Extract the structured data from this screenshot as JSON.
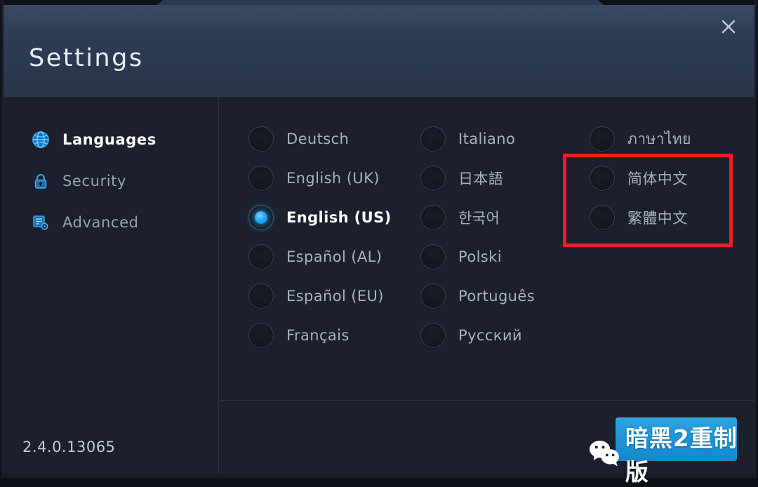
{
  "window": {
    "title": "Settings",
    "close_icon": "close-icon"
  },
  "sidebar": {
    "items": [
      {
        "label": "Languages",
        "icon": "globe-icon",
        "active": true
      },
      {
        "label": "Security",
        "icon": "lock-icon",
        "active": false
      },
      {
        "label": "Advanced",
        "icon": "advanced-settings-icon",
        "active": false
      }
    ]
  },
  "languages": {
    "selected": "English (US)",
    "columns": [
      {
        "options": [
          {
            "label": "Deutsch",
            "selected": false
          },
          {
            "label": "English (UK)",
            "selected": false
          },
          {
            "label": "English (US)",
            "selected": true
          },
          {
            "label": "Español (AL)",
            "selected": false
          },
          {
            "label": "Español (EU)",
            "selected": false
          },
          {
            "label": "Français",
            "selected": false
          }
        ]
      },
      {
        "options": [
          {
            "label": "Italiano",
            "selected": false
          },
          {
            "label": "日本語",
            "selected": false
          },
          {
            "label": "한국어",
            "selected": false
          },
          {
            "label": "Polski",
            "selected": false
          },
          {
            "label": "Português",
            "selected": false
          },
          {
            "label": "Русский",
            "selected": false
          }
        ]
      },
      {
        "options": [
          {
            "label": "ภาษาไทย",
            "selected": false
          },
          {
            "label": "简体中文",
            "selected": false
          },
          {
            "label": "繁體中文",
            "selected": false
          }
        ]
      }
    ]
  },
  "annotation": {
    "color": "#f01f1f",
    "highlights": [
      "简体中文",
      "繁體中文"
    ]
  },
  "footer": {
    "version": "2.4.0.13065",
    "primary_button_label": ""
  },
  "watermark": {
    "text": "暗黑2重制版",
    "icon": "wechat-icon"
  },
  "colors": {
    "accent": "#23a6f5",
    "header_bg": "#2c3a52",
    "panel_bg": "#1b202c",
    "annotation_red": "#f01f1f"
  }
}
